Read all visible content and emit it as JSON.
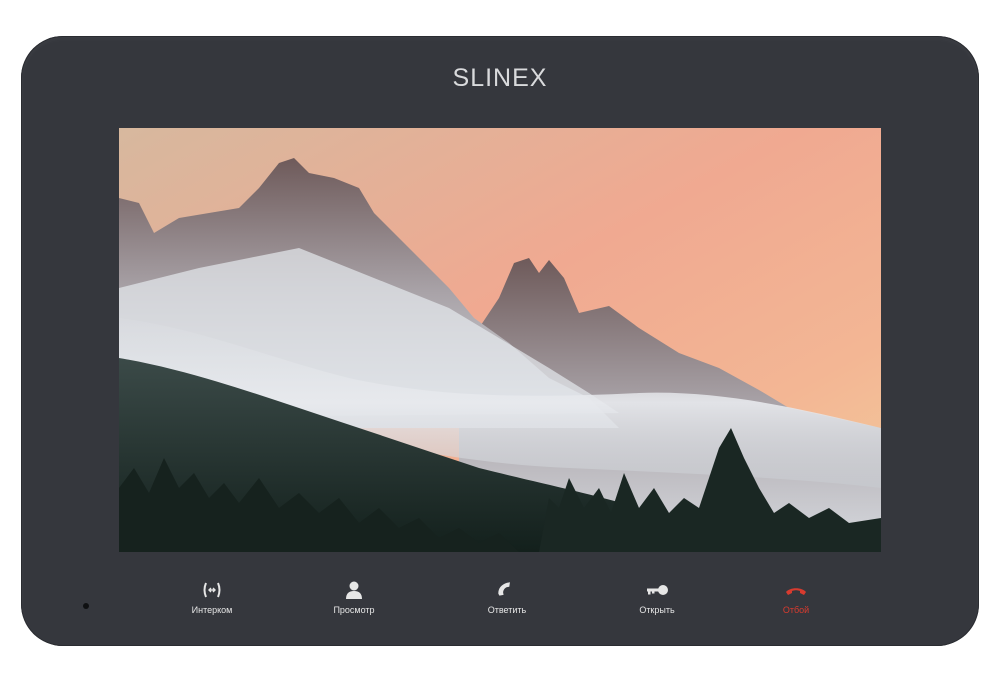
{
  "device": {
    "brand": "SLINEX",
    "colors": {
      "body": "#35373d",
      "label": "#e6e6e6",
      "hangup": "#d83b2f"
    }
  },
  "screen": {
    "image": "mountain-landscape-photo"
  },
  "controls": [
    {
      "name": "intercom",
      "label": "Интерком",
      "icon": "intercom-icon"
    },
    {
      "name": "view",
      "label": "Просмотр",
      "icon": "person-icon"
    },
    {
      "name": "answer",
      "label": "Ответить",
      "icon": "phone-icon"
    },
    {
      "name": "open",
      "label": "Открыть",
      "icon": "key-icon"
    },
    {
      "name": "hangup",
      "label": "Отбой",
      "icon": "hangup-icon"
    }
  ]
}
